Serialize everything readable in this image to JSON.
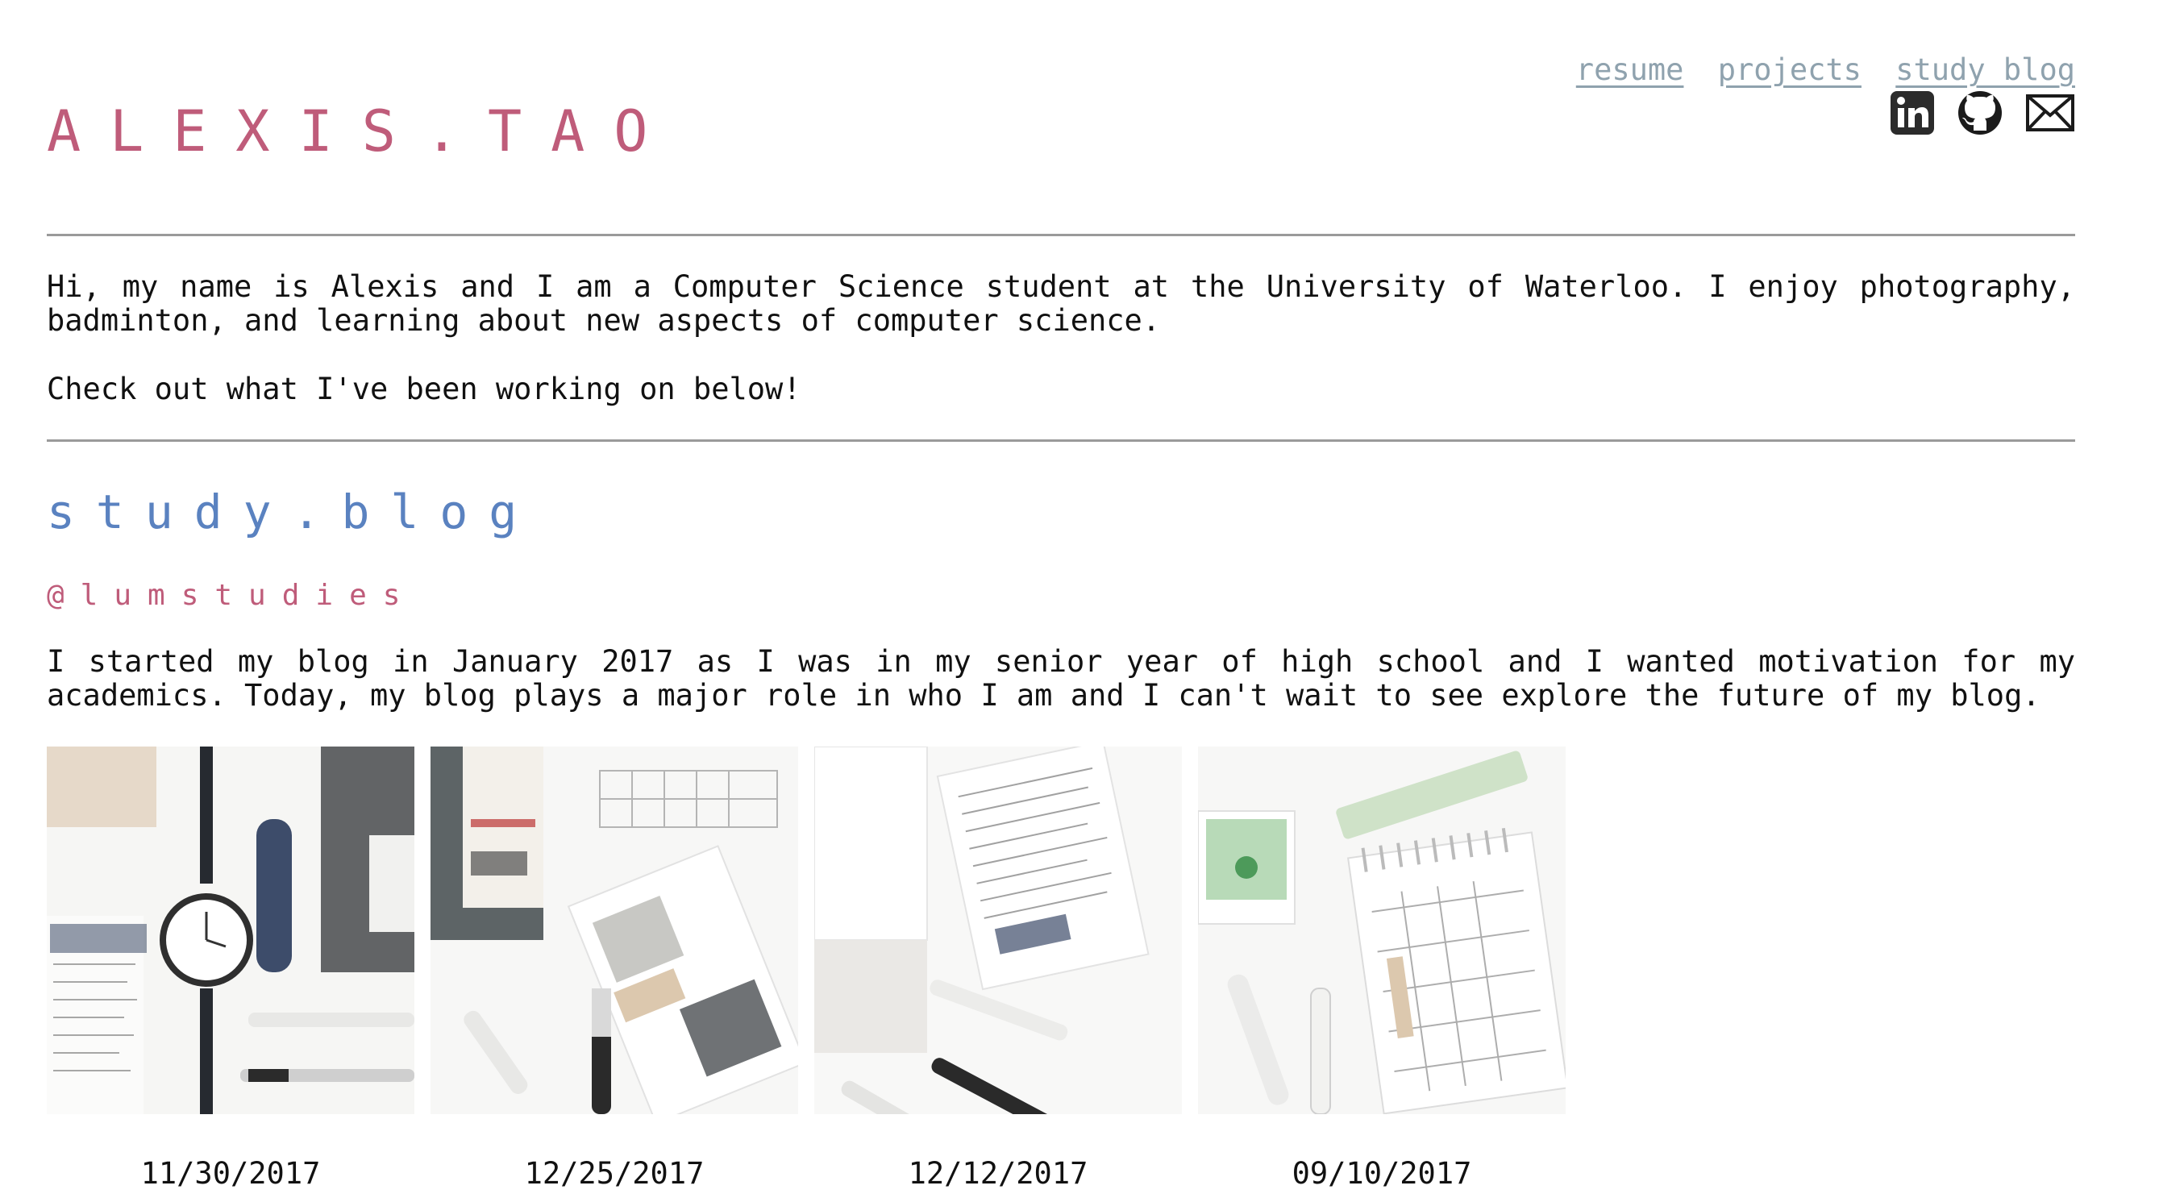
{
  "header": {
    "title": "ALEXIS.TAO",
    "nav": [
      {
        "label": "resume"
      },
      {
        "label": "projects"
      },
      {
        "label": "study blog"
      }
    ],
    "social": [
      {
        "icon": "linkedin-icon"
      },
      {
        "icon": "github-icon"
      },
      {
        "icon": "mail-icon"
      }
    ]
  },
  "intro": {
    "paragraph": "Hi, my name is Alexis and I am a Computer Science student at the University of Waterloo. I enjoy photography, badminton, and learning about new aspects of computer science.",
    "cta": "Check out what I've been working on below!"
  },
  "blog": {
    "title": "study.blog",
    "handle": "@lumstudies",
    "description": "I started my blog in January 2017 as I was in my senior year of high school and I wanted motivation for my academics. Today, my blog plays a major role in who I am and I can't wait to see explore the future of my blog.",
    "posts": [
      {
        "date": "11/30/2017"
      },
      {
        "date": "12/25/2017"
      },
      {
        "date": "12/12/2017"
      },
      {
        "date": "09/10/2017"
      }
    ]
  },
  "colors": {
    "title_pink": "#bf5c7a",
    "section_blue": "#5a82c0",
    "link_gray": "#8fa2ae",
    "rule_gray": "#9a9a9a"
  }
}
